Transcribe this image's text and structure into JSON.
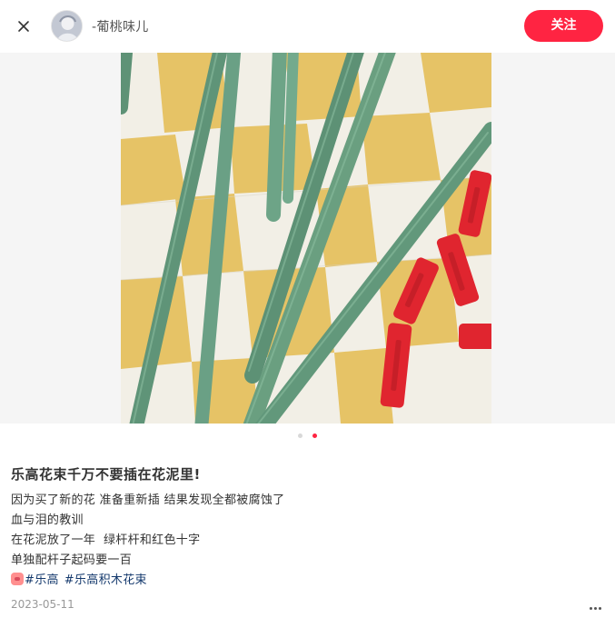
{
  "header": {
    "author_name": "-葡桃味儿",
    "follow_label": "关注",
    "close_icon": "close-icon"
  },
  "carousel": {
    "current_index": 2,
    "total": 2
  },
  "post": {
    "title": "乐高花束千万不要插在花泥里!",
    "desc_lines": [
      "因为买了新的花 准备重新插 结果发现全都被腐蚀了",
      "血与泪的教训",
      "在花泥放了一年  绿杆杆和红色十字",
      "单独配杆子起码要一百"
    ],
    "tags": [
      "#乐高",
      "#乐高积木花束"
    ],
    "date": "2023-05-11"
  },
  "colors": {
    "accent": "#ff2442",
    "tag": "#13386c",
    "stem": "#6a9f80",
    "brick": "#e0252f",
    "checker_yellow": "#e6c366",
    "checker_cream": "#f2efe6"
  }
}
